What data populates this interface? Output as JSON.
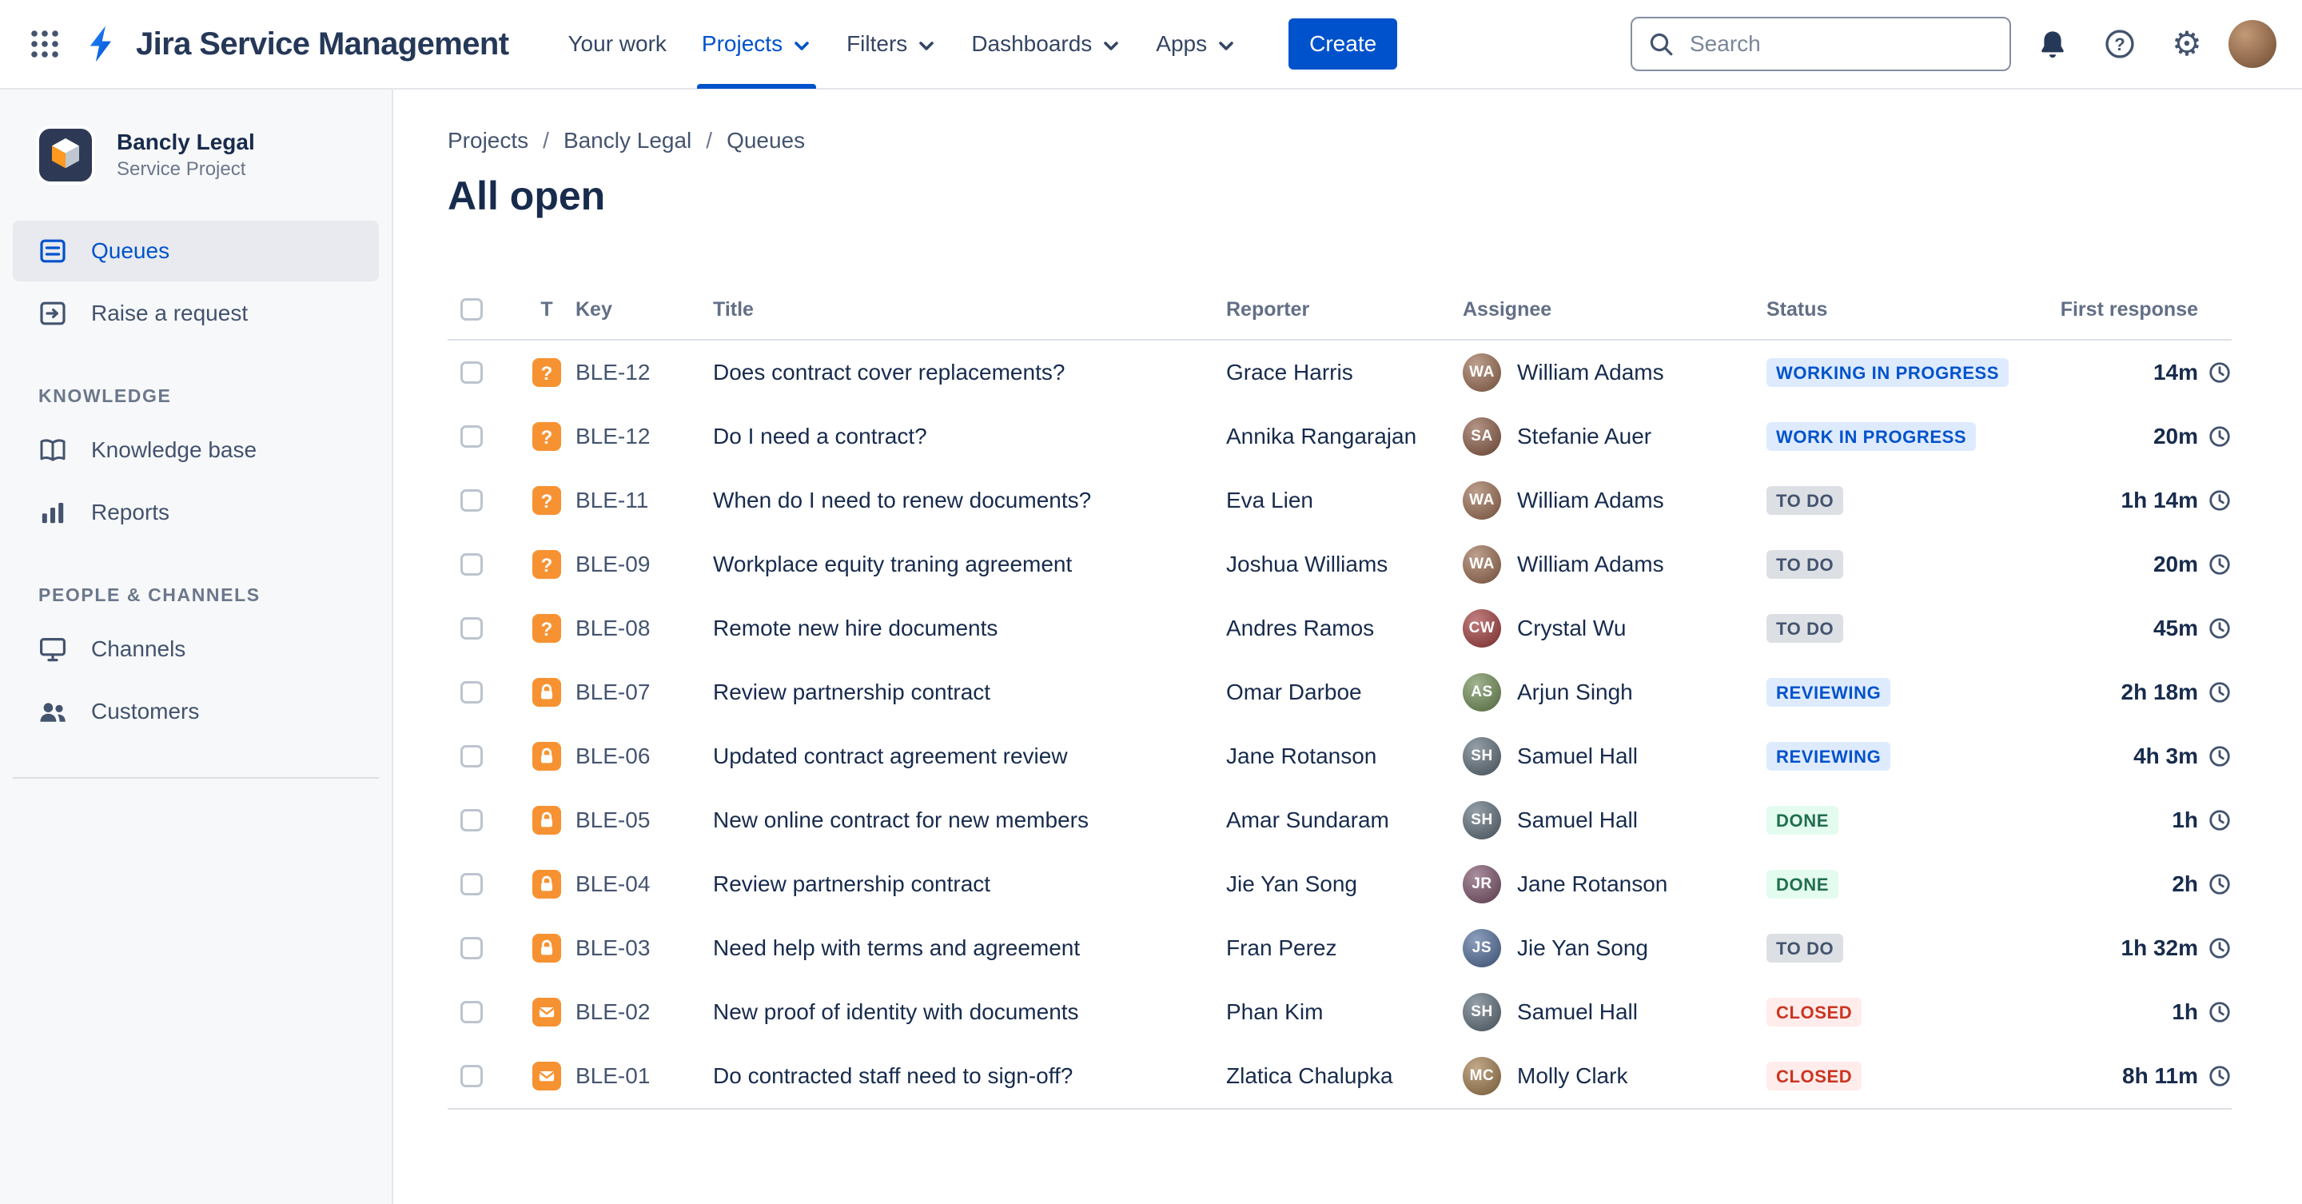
{
  "colors": {
    "accent_blue": "#0052CC",
    "brand_text": "#253858",
    "type_icon_bg": "#F79232",
    "status_inprogress_bg": "#DEEBFF",
    "status_inprogress_text": "#0052CC",
    "status_todo_bg": "#DCDFE4",
    "status_todo_text": "#44546F",
    "status_done_bg": "#E3FCEF",
    "status_done_text": "#216E4E",
    "status_closed_bg": "#FFECEB",
    "status_closed_text": "#CA3521"
  },
  "icons": {
    "settings_glyph": "⚙",
    "app_switcher": "grid-dots",
    "search": "magnifier",
    "notifications": "bell",
    "help": "question-circle",
    "clock": "clock-outline"
  },
  "topbar": {
    "app_title": "Jira Service Management",
    "nav_your_work": "Your work",
    "nav_projects": "Projects",
    "nav_filters": "Filters",
    "nav_dashboards": "Dashboards",
    "nav_apps": "Apps",
    "create_label": "Create",
    "search_placeholder": "Search"
  },
  "sidebar": {
    "project_name": "Bancly Legal",
    "project_type": "Service Project",
    "queues_label": "Queues",
    "raise_request_label": "Raise a request",
    "knowledge_header": "KNOWLEDGE",
    "knowledge_base_label": "Knowledge base",
    "reports_label": "Reports",
    "people_header": "PEOPLE & CHANNELS",
    "channels_label": "Channels",
    "customers_label": "Customers"
  },
  "breadcrumb": {
    "projects": "Projects",
    "project": "Bancly Legal",
    "queues": "Queues"
  },
  "page_title": "All open",
  "table": {
    "col_t": "T",
    "col_key": "Key",
    "col_title": "Title",
    "col_reporter": "Reporter",
    "col_assignee": "Assignee",
    "col_status": "Status",
    "col_first_response": "First response",
    "rows": [
      {
        "type": "question",
        "key": "BLE-12",
        "title": "Does contract cover replacements?",
        "reporter": "Grace Harris",
        "assignee": "William Adams",
        "assignee_initials": "WA",
        "avatar_color": "#9A6B4F",
        "status": "WORKING IN PROGRESS",
        "status_type": "inprogress",
        "response": "14m"
      },
      {
        "type": "question",
        "key": "BLE-12",
        "title": "Do I need a contract?",
        "reporter": "Annika Rangarajan",
        "assignee": "Stefanie Auer",
        "assignee_initials": "SA",
        "avatar_color": "#8A5A44",
        "status": "WORK IN PROGRESS",
        "status_type": "inprogress",
        "response": "20m"
      },
      {
        "type": "question",
        "key": "BLE-11",
        "title": "When do I need to renew documents?",
        "reporter": "Eva Lien",
        "assignee": "William Adams",
        "assignee_initials": "WA",
        "avatar_color": "#9A6B4F",
        "status": "TO DO",
        "status_type": "todo",
        "response": "1h 14m"
      },
      {
        "type": "question",
        "key": "BLE-09",
        "title": "Workplace equity traning agreement",
        "reporter": "Joshua Williams",
        "assignee": "William Adams",
        "assignee_initials": "WA",
        "avatar_color": "#9A6B4F",
        "status": "TO DO",
        "status_type": "todo",
        "response": "20m"
      },
      {
        "type": "question",
        "key": "BLE-08",
        "title": "Remote new hire documents",
        "reporter": "Andres Ramos",
        "assignee": "Crystal Wu",
        "assignee_initials": "CW",
        "avatar_color": "#A13A3A",
        "status": "TO DO",
        "status_type": "todo",
        "response": "45m"
      },
      {
        "type": "lock",
        "key": "BLE-07",
        "title": "Review partnership contract",
        "reporter": "Omar Darboe",
        "assignee": "Arjun Singh",
        "assignee_initials": "AS",
        "avatar_color": "#6E8B53",
        "status": "REVIEWING",
        "status_type": "inprogress",
        "response": "2h 18m"
      },
      {
        "type": "lock",
        "key": "BLE-06",
        "title": "Updated contract agreement review",
        "reporter": "Jane Rotanson",
        "assignee": "Samuel Hall",
        "assignee_initials": "SH",
        "avatar_color": "#5B6B78",
        "status": "REVIEWING",
        "status_type": "inprogress",
        "response": "4h 3m"
      },
      {
        "type": "lock",
        "key": "BLE-05",
        "title": "New online contract for new members",
        "reporter": "Amar Sundaram",
        "assignee": "Samuel Hall",
        "assignee_initials": "SH",
        "avatar_color": "#5B6B78",
        "status": "DONE",
        "status_type": "done",
        "response": "1h"
      },
      {
        "type": "lock",
        "key": "BLE-04",
        "title": "Review partnership contract",
        "reporter": "Jie Yan Song",
        "assignee": "Jane Rotanson",
        "assignee_initials": "JR",
        "avatar_color": "#7A5068",
        "status": "DONE",
        "status_type": "done",
        "response": "2h"
      },
      {
        "type": "lock",
        "key": "BLE-03",
        "title": "Need help with terms and agreement",
        "reporter": "Fran Perez",
        "assignee": "Jie Yan Song",
        "assignee_initials": "JS",
        "avatar_color": "#4F6B9A",
        "status": "TO DO",
        "status_type": "todo",
        "response": "1h 32m"
      },
      {
        "type": "email",
        "key": "BLE-02",
        "title": "New proof of identity with documents",
        "reporter": "Phan Kim",
        "assignee": "Samuel Hall",
        "assignee_initials": "SH",
        "avatar_color": "#5B6B78",
        "status": "CLOSED",
        "status_type": "closed",
        "response": "1h"
      },
      {
        "type": "email",
        "key": "BLE-01",
        "title": "Do contracted staff need to sign-off?",
        "reporter": "Zlatica Chalupka",
        "assignee": "Molly Clark",
        "assignee_initials": "MC",
        "avatar_color": "#A07A4A",
        "status": "CLOSED",
        "status_type": "closed",
        "response": "8h 11m"
      }
    ]
  }
}
